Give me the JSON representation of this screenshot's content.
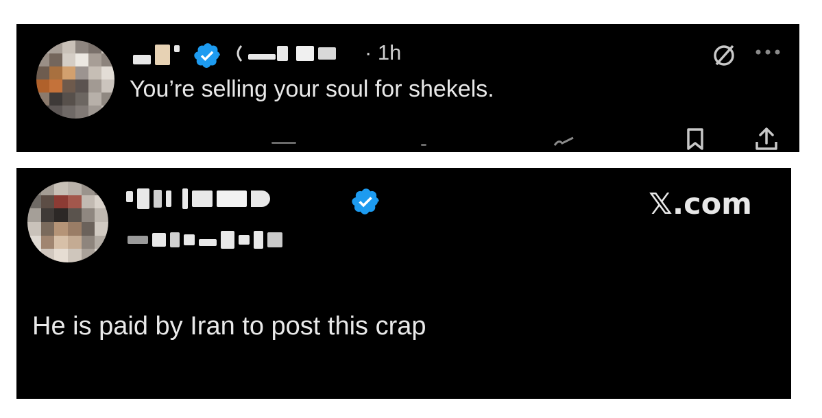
{
  "posts": [
    {
      "time": "· 1h",
      "text": "You’re selling your soul for shekels.",
      "icons": [
        "avatar-blurred",
        "verified-badge-icon",
        "grok-icon",
        "more-icon",
        "bookmark-icon",
        "share-icon"
      ]
    },
    {
      "text": "He is paid by Iran to post this crap",
      "watermark": "𝕏.com",
      "icons": [
        "avatar-blurred",
        "verified-badge-icon"
      ]
    }
  ],
  "colors": {
    "background": "#000000",
    "text": "#e9e9e9",
    "verified": "#1d9bf0",
    "page": "#ffffff"
  }
}
